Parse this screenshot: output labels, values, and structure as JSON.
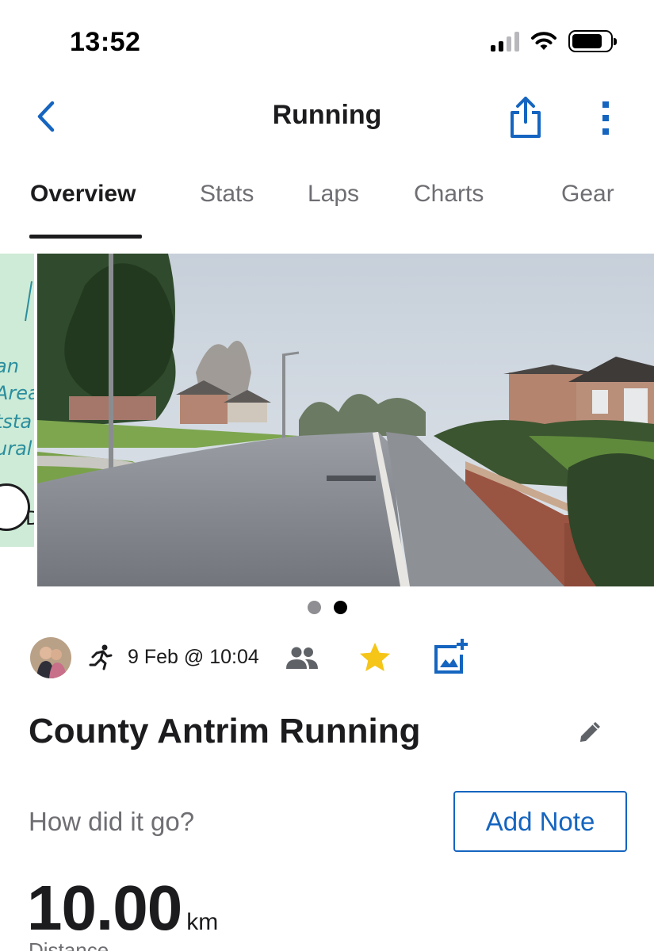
{
  "status_bar": {
    "time": "13:52",
    "icons": [
      "signal-icon",
      "wifi-icon",
      "battery-icon"
    ]
  },
  "nav": {
    "title": "Running",
    "icons": [
      "back-chevron-icon",
      "share-icon",
      "more-vertical-icon"
    ]
  },
  "tabs": [
    {
      "label": "Overview",
      "active": true
    },
    {
      "label": "Stats",
      "active": false
    },
    {
      "label": "Laps",
      "active": false
    },
    {
      "label": "Charts",
      "active": false
    },
    {
      "label": "Gear",
      "active": false
    }
  ],
  "carousel": {
    "map_peek_fragments": [
      "an",
      "Area",
      "tsta",
      "ural",
      "D"
    ],
    "slide_count": 2,
    "active_slide": 2
  },
  "meta": {
    "date": "9 Feb @ 10:04",
    "icons": [
      "avatar",
      "running-icon",
      "people-icon",
      "star-icon",
      "add-photo-icon"
    ],
    "favorited": true
  },
  "activity": {
    "title": "County Antrim Running",
    "note_prompt": "How did it go?",
    "add_note_label": "Add Note",
    "distance_value": "10.00",
    "distance_unit": "km",
    "distance_label": "Distance"
  },
  "colors": {
    "accent": "#1565c0",
    "star": "#f5c518",
    "text_primary": "#1c1c1e",
    "text_secondary": "#6e6e73"
  }
}
